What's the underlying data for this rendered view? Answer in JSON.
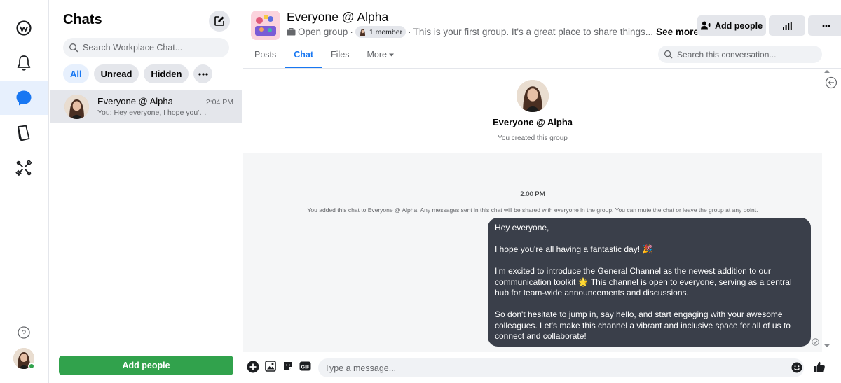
{
  "colors": {
    "accent": "#1877f2",
    "green": "#31a24c",
    "bubble": "#3a3f4a"
  },
  "rail": {
    "items": [
      {
        "icon": "workplace-logo-icon"
      },
      {
        "icon": "bell-icon"
      },
      {
        "icon": "chat-icon",
        "active": true
      },
      {
        "icon": "book-icon"
      },
      {
        "icon": "tools-icon"
      }
    ],
    "help_icon": "help-icon"
  },
  "chat_list": {
    "title": "Chats",
    "search_placeholder": "Search Workplace Chat...",
    "filters": [
      "All",
      "Unread",
      "Hidden"
    ],
    "conversations": [
      {
        "name": "Everyone @ Alpha",
        "time": "2:04 PM",
        "preview": "You: Hey everyone, I hope you're..."
      }
    ],
    "add_people_label": "Add people"
  },
  "header": {
    "title": "Everyone @ Alpha",
    "group_type": "Open group",
    "member_count": "1 member",
    "description": "This is your first group. It's a great place to share things...",
    "see_more": "See more",
    "add_people": "Add people",
    "tabs": [
      "Posts",
      "Chat",
      "Files",
      "More"
    ],
    "active_tab": "Chat",
    "search_placeholder": "Search this conversation..."
  },
  "thread": {
    "intro_name": "Everyone @ Alpha",
    "intro_sub": "You created this group",
    "timestamp": "2:00 PM",
    "system_message": "You added this chat to Everyone @ Alpha. Any messages sent in this chat will be shared with everyone in the group. You can mute the chat or leave the group at any point.",
    "message": {
      "p1": "Hey everyone,",
      "p2": "I hope you're all having a fantastic day! 🎉",
      "p3": "I'm excited to introduce the General Channel as the newest addition to our communication toolkit 🌟 This channel is open to everyone, serving as a central hub for team-wide announcements and discussions.",
      "p4": "So don't hesitate to jump in, say hello, and start engaging with your awesome colleagues. Let's make this channel a vibrant and inclusive space for all of us to connect and collaborate!"
    }
  },
  "composer": {
    "placeholder": "Type a message..."
  }
}
